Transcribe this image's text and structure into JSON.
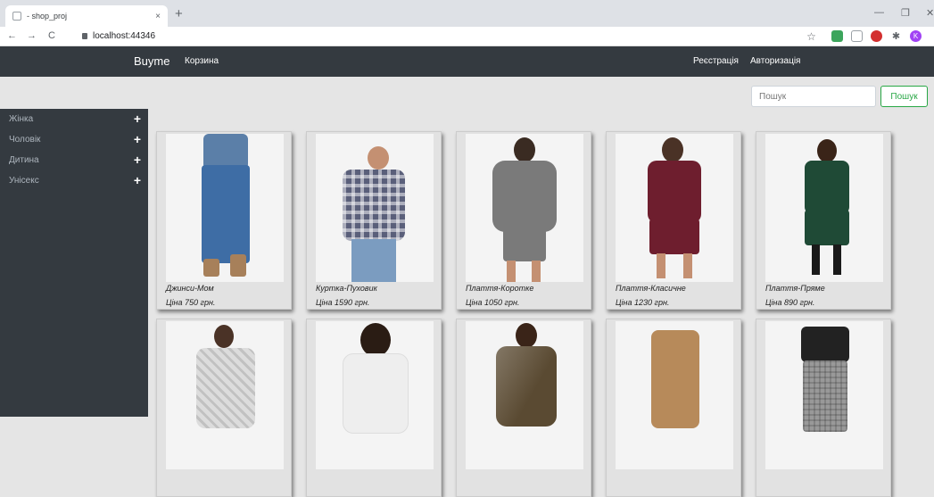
{
  "browser": {
    "tab_title": "- shop_proj",
    "tab_close": "×",
    "new_tab": "+",
    "url": "localhost:44346",
    "nav": {
      "back": "←",
      "forward": "→",
      "reload": "C"
    },
    "window_controls": {
      "minimize": "—",
      "restore": "❐",
      "close": "✕"
    },
    "extensions": [
      "star-icon",
      "extension-green-icon",
      "pocket-icon",
      "opera-icon",
      "puzzle-icon",
      "profile-avatar"
    ],
    "profile_initial": "K"
  },
  "navbar": {
    "brand": "Buyme",
    "cart": "Корзина",
    "register": "Реєстрація",
    "login": "Авторизація"
  },
  "search": {
    "placeholder": "Пошук",
    "button": "Пошук"
  },
  "sidebar": {
    "items": [
      {
        "label": "Жінка",
        "icon": "plus-icon",
        "expander": "+"
      },
      {
        "label": "Чоловік",
        "icon": "plus-icon",
        "expander": "+"
      },
      {
        "label": "Дитина",
        "icon": "plus-icon",
        "expander": "+"
      },
      {
        "label": "Унісекс",
        "icon": "plus-icon",
        "expander": "+"
      }
    ]
  },
  "products": [
    {
      "name": "Джинси-Мом",
      "price": "Ціна 750 грн.",
      "top_color": "#5b7fa8",
      "bottom_color": "#3e6da5"
    },
    {
      "name": "Куртка-Пуховик",
      "price": "Ціна 1590 грн.",
      "top_color": "#5a5f7a",
      "bottom_color": "#7b9cc0"
    },
    {
      "name": "Плаття-Коротке",
      "price": "Ціна 1050 грн.",
      "top_color": "#7a7a7a",
      "bottom_color": "#7a7a7a"
    },
    {
      "name": "Плаття-Класичне",
      "price": "Ціна 1230 грн.",
      "top_color": "#6e1e2e",
      "bottom_color": "#6e1e2e"
    },
    {
      "name": "Плаття-Пряме",
      "price": "Ціна 890 грн.",
      "top_color": "#1f4a36",
      "bottom_color": "#1f4a36"
    },
    {
      "name": "",
      "price": "",
      "top_color": "#dcdcdc",
      "bottom_color": "#dcdcdc"
    },
    {
      "name": "",
      "price": "",
      "top_color": "#eeeeee",
      "bottom_color": "#eeeeee"
    },
    {
      "name": "",
      "price": "",
      "top_color": "#5a4a32",
      "bottom_color": "#5a4a32"
    },
    {
      "name": "",
      "price": "",
      "top_color": "#b78a5a",
      "bottom_color": "#b78a5a"
    },
    {
      "name": "",
      "price": "",
      "top_color": "#222222",
      "bottom_color": "#999999"
    }
  ]
}
